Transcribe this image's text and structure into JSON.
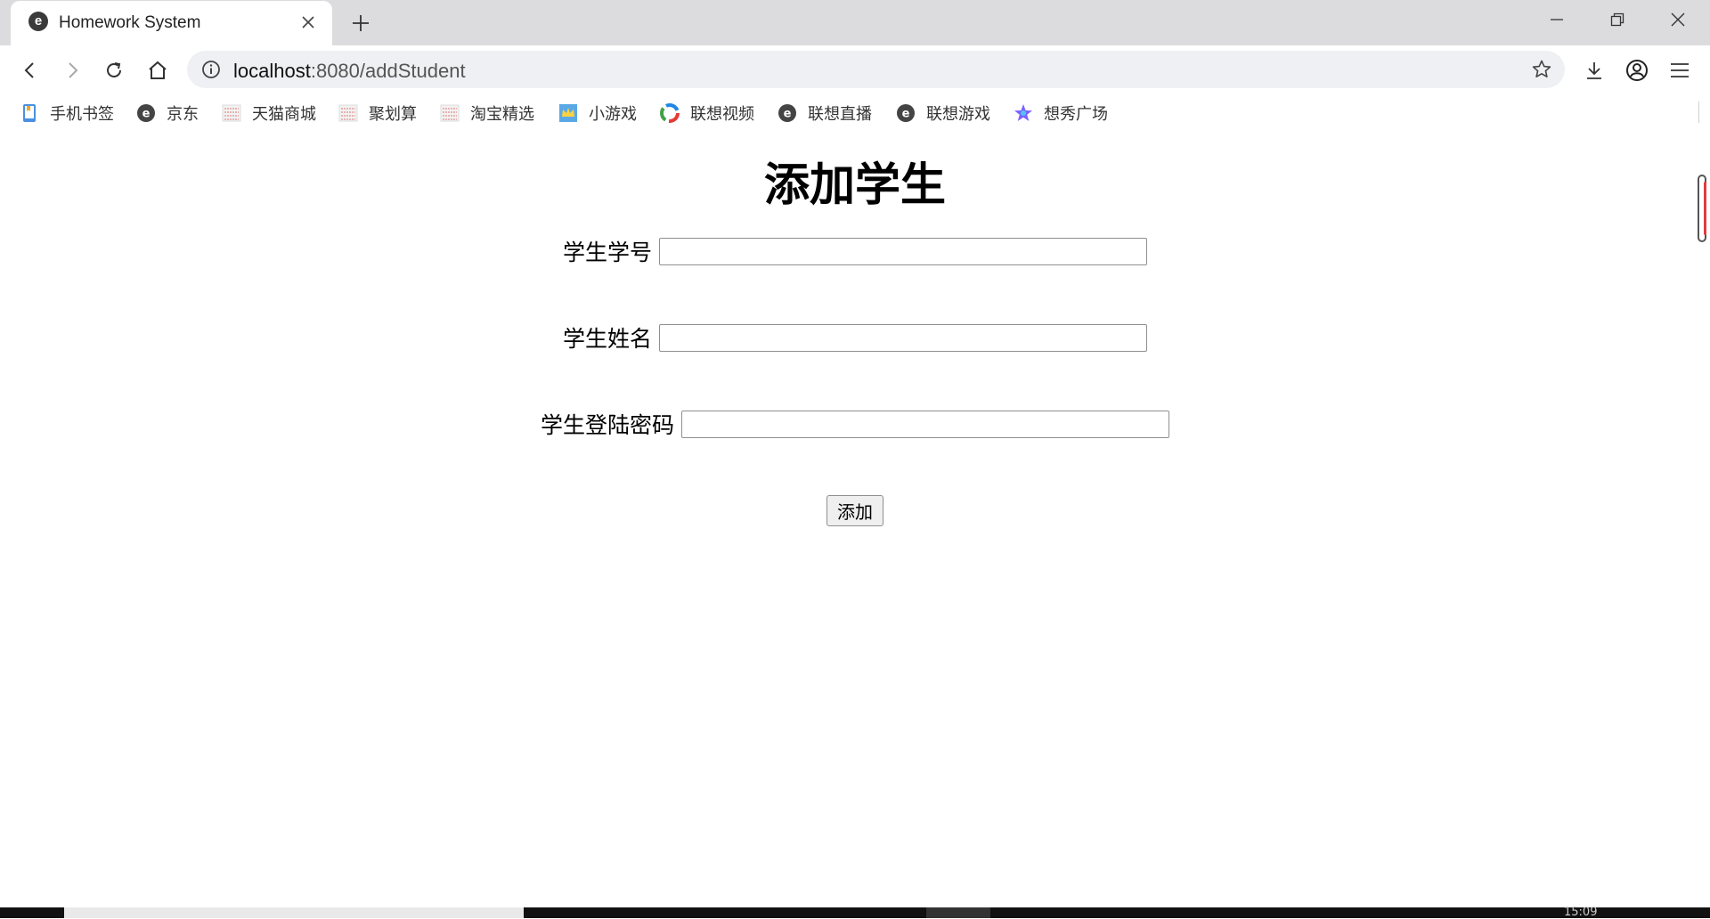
{
  "browser": {
    "tab": {
      "title": "Homework System",
      "favicon_glyph": "e"
    },
    "new_tab_icon": "plus-icon",
    "window_controls": [
      "minimize-icon",
      "restore-icon",
      "close-icon"
    ],
    "address_bar": {
      "host": "localhost",
      "path": ":8080/addStudent"
    },
    "bookmarks": [
      {
        "label": "手机书签",
        "icon": "phone-bookmark-icon"
      },
      {
        "label": "京东",
        "icon": "edge-e-icon"
      },
      {
        "label": "天猫商城",
        "icon": "site-thumbnail-icon"
      },
      {
        "label": "聚划算",
        "icon": "site-thumbnail-icon"
      },
      {
        "label": "淘宝精选",
        "icon": "site-thumbnail-icon"
      },
      {
        "label": "小游戏",
        "icon": "crown-icon"
      },
      {
        "label": "联想视频",
        "icon": "color-ring-icon"
      },
      {
        "label": "联想直播",
        "icon": "edge-e-icon"
      },
      {
        "label": "联想游戏",
        "icon": "edge-e-icon"
      },
      {
        "label": "想秀广场",
        "icon": "star-icon"
      }
    ]
  },
  "page": {
    "title": "添加学生",
    "fields": {
      "student_id": {
        "label": "学生学号",
        "value": ""
      },
      "student_name": {
        "label": "学生姓名",
        "value": ""
      },
      "student_password": {
        "label": "学生登陆密码",
        "value": ""
      }
    },
    "submit_label": "添加"
  },
  "taskbar": {
    "clock": "15:09"
  },
  "colors": {
    "tabstrip_bg": "#dcdcde",
    "omnibox_bg": "#eef0f3",
    "scroll_accent": "#e23b3b"
  }
}
